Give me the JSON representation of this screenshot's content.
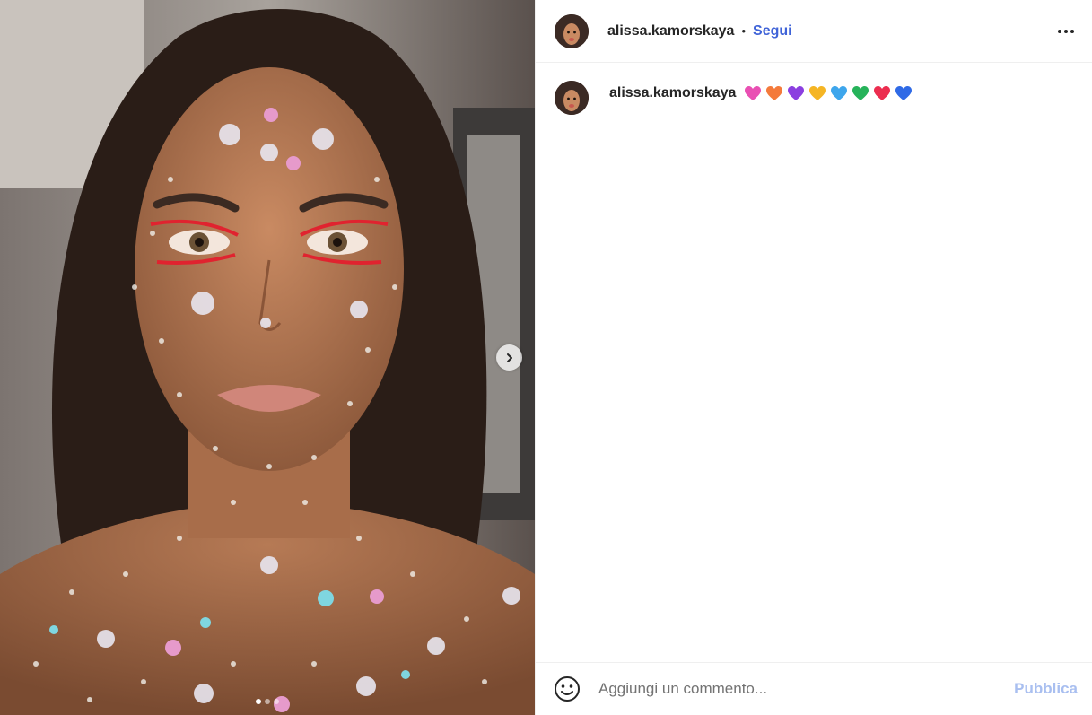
{
  "post": {
    "author": "alissa.kamorskaya",
    "separator": "•",
    "follow_label": "Segui",
    "more_icon": "more-options-icon",
    "photo_description_icon": "post-photo",
    "carousel": {
      "total": 3,
      "active": 1
    }
  },
  "caption": {
    "author": "alissa.kamorskaya",
    "emojis": [
      {
        "name": "pink-heart-icon",
        "color": "#e94fb3"
      },
      {
        "name": "orange-heart-icon",
        "color": "#f47a3b"
      },
      {
        "name": "purple-heart-icon",
        "color": "#8b3fe0"
      },
      {
        "name": "yellow-heart-icon",
        "color": "#f5b524"
      },
      {
        "name": "light-blue-heart-icon",
        "color": "#3ea6ec"
      },
      {
        "name": "green-heart-icon",
        "color": "#26b35a"
      },
      {
        "name": "red-heart-icon",
        "color": "#ec2d4f"
      },
      {
        "name": "blue-heart-icon",
        "color": "#2f6ae6"
      }
    ]
  },
  "comment_box": {
    "placeholder": "Aggiungi un commento...",
    "submit_label": "Pubblica",
    "emoji_icon": "emoji-smile-icon"
  },
  "colors": {
    "follow": "#3f63d8",
    "submit_disabled": "#a9bff0",
    "divider": "#efefef"
  }
}
